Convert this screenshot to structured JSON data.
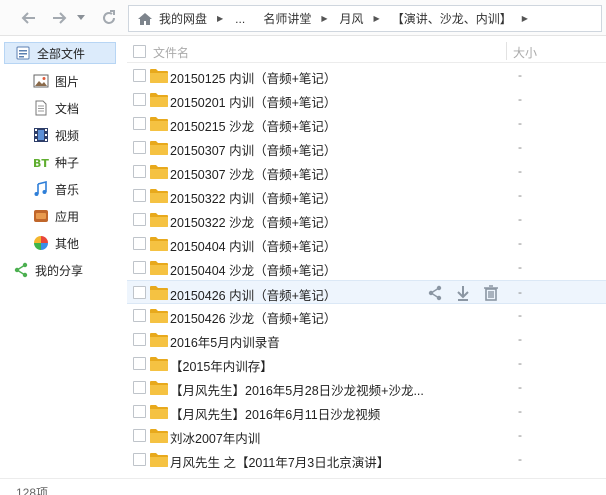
{
  "nav": {
    "back_icon": "back-arrow-icon",
    "forward_icon": "forward-arrow-icon",
    "refresh_icon": "refresh-icon"
  },
  "breadcrumb": {
    "items": [
      "我的网盘",
      "...",
      "名师讲堂",
      "月风",
      "【演讲、沙龙、内训】"
    ]
  },
  "sidebar": {
    "items": [
      {
        "label": "全部文件",
        "icon": "all-files-icon"
      },
      {
        "label": "图片",
        "icon": "image-icon"
      },
      {
        "label": "文档",
        "icon": "document-icon"
      },
      {
        "label": "视频",
        "icon": "video-icon"
      },
      {
        "label": "种子",
        "icon": "bt-icon"
      },
      {
        "label": "音乐",
        "icon": "music-icon"
      },
      {
        "label": "应用",
        "icon": "app-icon"
      },
      {
        "label": "其他",
        "icon": "other-icon"
      },
      {
        "label": "我的分享",
        "icon": "share-icon"
      }
    ]
  },
  "list": {
    "headers": {
      "name": "文件名",
      "size": "大小"
    },
    "rows": [
      {
        "name": "20150125 内训（音频+笔记）",
        "size": "-"
      },
      {
        "name": "20150201 内训（音频+笔记）",
        "size": "-"
      },
      {
        "name": "20150215 沙龙（音频+笔记）",
        "size": "-"
      },
      {
        "name": "20150307 内训（音频+笔记）",
        "size": "-"
      },
      {
        "name": "20150307 沙龙（音频+笔记）",
        "size": "-"
      },
      {
        "name": "20150322 内训（音频+笔记）",
        "size": "-"
      },
      {
        "name": "20150322 沙龙（音频+笔记）",
        "size": "-"
      },
      {
        "name": "20150404 内训（音频+笔记）",
        "size": "-"
      },
      {
        "name": "20150404 沙龙（音频+笔记）",
        "size": "-"
      },
      {
        "name": "20150426 内训（音频+笔记）",
        "size": "-"
      },
      {
        "name": "20150426 沙龙（音频+笔记）",
        "size": "-"
      },
      {
        "name": "2016年5月内训录音",
        "size": "-"
      },
      {
        "name": "【2015年内训存】",
        "size": "-"
      },
      {
        "name": "【月风先生】2016年5月28日沙龙视频+沙龙...",
        "size": "-"
      },
      {
        "name": "【月风先生】2016年6月11日沙龙视频",
        "size": "-"
      },
      {
        "name": "刘冰2007年内训",
        "size": "-"
      },
      {
        "name": "月风先生 之【2011年7月3日北京演讲】",
        "size": "-"
      }
    ],
    "hover_actions": [
      "share-icon",
      "download-icon",
      "delete-icon"
    ]
  },
  "footer": {
    "count": "128项"
  },
  "colors": {
    "folder": "#f3b92b",
    "selected_bg": "#dcebfb",
    "hover_bg": "#eef5fd"
  }
}
